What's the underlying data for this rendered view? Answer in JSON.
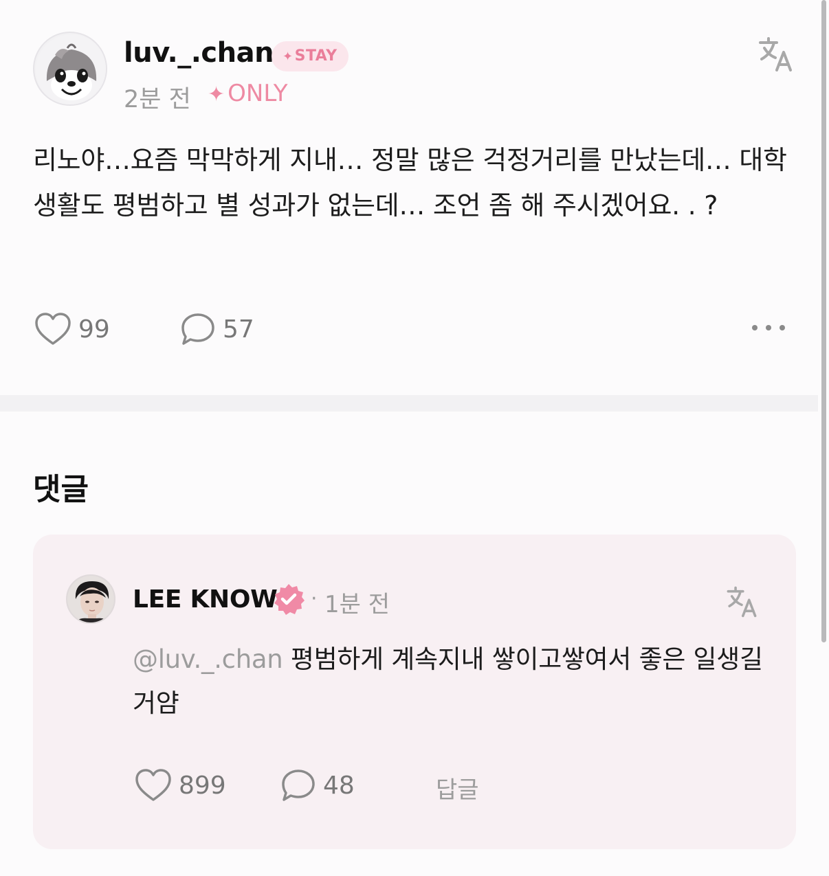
{
  "post": {
    "username": "luv._.chan",
    "badge": "STAY",
    "badge_star": "✦",
    "time": "2분 전",
    "only_star": "✦",
    "only_label": "ONLY",
    "body": "리노야…요즘 막막하게 지내… 정말 많은 걱정거리를 만났는데… 대학생활도 평범하고 별 성과가 없는데… 조언 좀 해 주시겠어요. . ?",
    "likes": "99",
    "comments": "57",
    "icons": [
      "avatar",
      "translate-icon",
      "heart-icon",
      "comment-bubble-icon",
      "more-dots-icon"
    ]
  },
  "comments_section": {
    "title": "댓글"
  },
  "comment": {
    "author": "LEE KNOW",
    "separator": "·",
    "time": "1분 전",
    "mention": "@luv._.chan",
    "text": " 평범하게 계속지내 쌓이고쌓여서 좋은 일생길거얌",
    "likes": "899",
    "replies": "48",
    "reply_label": "답글",
    "icons": [
      "avatar",
      "verified-badge-icon",
      "translate-icon",
      "heart-icon",
      "comment-bubble-icon"
    ]
  },
  "colors": {
    "accent_pink": "#ee8aa3",
    "badge_bg": "#fbe6ec",
    "card_bg": "#f8f0f3",
    "muted_text": "#9c9c9c"
  }
}
